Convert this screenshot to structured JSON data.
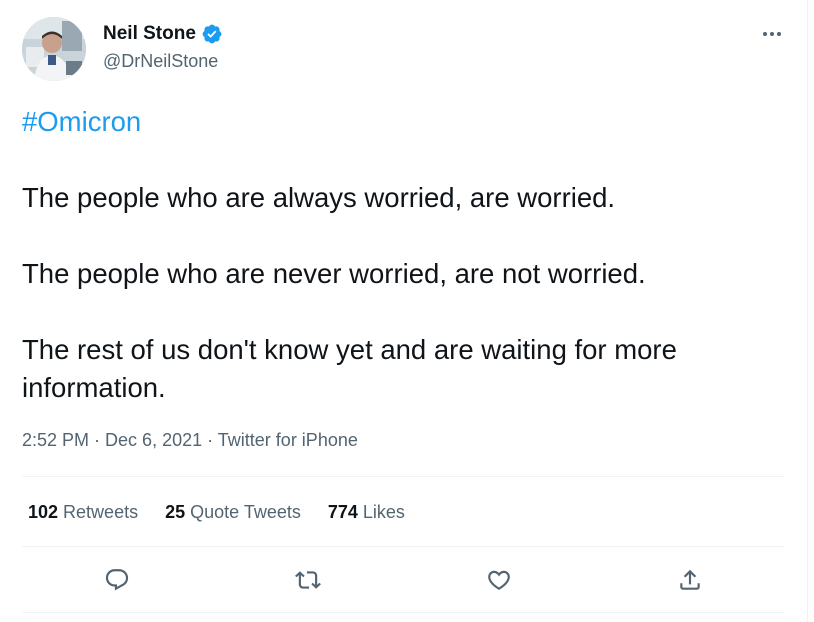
{
  "author": {
    "display_name": "Neil Stone",
    "handle": "@DrNeilStone",
    "verified": true
  },
  "tweet": {
    "hashtag": "#Omicron",
    "paragraphs": [
      "The people who are always worried, are worried.",
      "The people who are never worried, are not worried.",
      "The rest of us don't know yet and are waiting for more information."
    ]
  },
  "meta": {
    "time": "2:52 PM",
    "separator": " · ",
    "date": "Dec 6, 2021",
    "source": "Twitter for iPhone"
  },
  "stats": {
    "retweets_count": "102",
    "retweets_label": "Retweets",
    "quotes_count": "25",
    "quotes_label": "Quote Tweets",
    "likes_count": "774",
    "likes_label": "Likes"
  },
  "icons": {
    "verified": "verified-badge-icon",
    "more": "more-options-icon",
    "reply": "reply-icon",
    "retweet": "retweet-icon",
    "like": "heart-icon",
    "share": "share-icon"
  },
  "colors": {
    "accent": "#1d9bf0",
    "text": "#0f1419",
    "secondary": "#536471",
    "divider": "#eff3f4"
  }
}
